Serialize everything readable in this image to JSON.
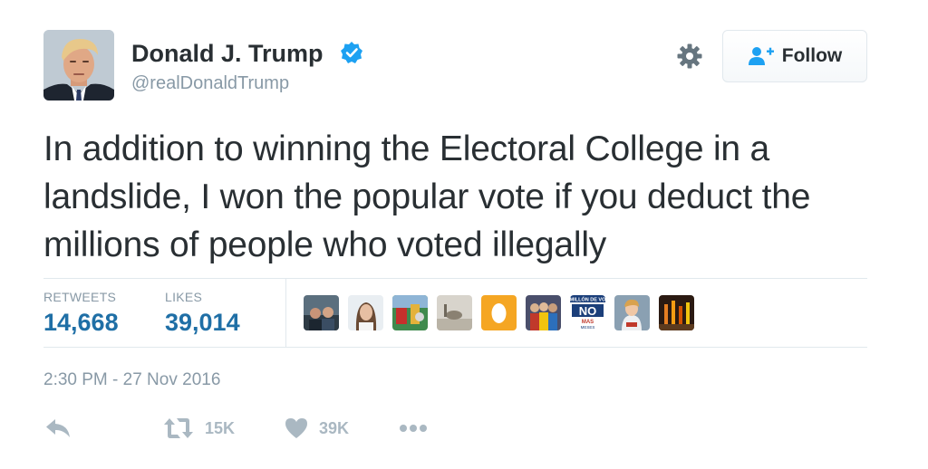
{
  "header": {
    "display_name": "Donald J. Trump",
    "handle": "@realDonaldTrump",
    "follow_label": "Follow"
  },
  "tweet": {
    "text": "In addition to winning the Electoral College in a landslide, I won the popular vote if you deduct the millions of people who voted illegally"
  },
  "stats": {
    "retweets_label": "RETWEETS",
    "retweets_value": "14,668",
    "likes_label": "LIKES",
    "likes_value": "39,014"
  },
  "likers": {
    "poster_text_1": "MILLÓN DE VO",
    "poster_text_2": "NO",
    "poster_text_3": "MAS",
    "poster_text_4": "MESES"
  },
  "timestamp": "2:30 PM - 27 Nov 2016",
  "actions": {
    "retweet_count": "15K",
    "like_count": "39K"
  },
  "colors": {
    "accent": "#1f6fa6",
    "verified": "#1da1f2",
    "muted": "#8899a6",
    "action_icon": "#aab8c2"
  },
  "icons": {
    "verified": "verified-badge-icon",
    "settings": "gear-icon",
    "follow": "add-user-icon",
    "reply": "reply-icon",
    "retweet": "retweet-icon",
    "like": "heart-icon",
    "more": "more-dots-icon"
  }
}
